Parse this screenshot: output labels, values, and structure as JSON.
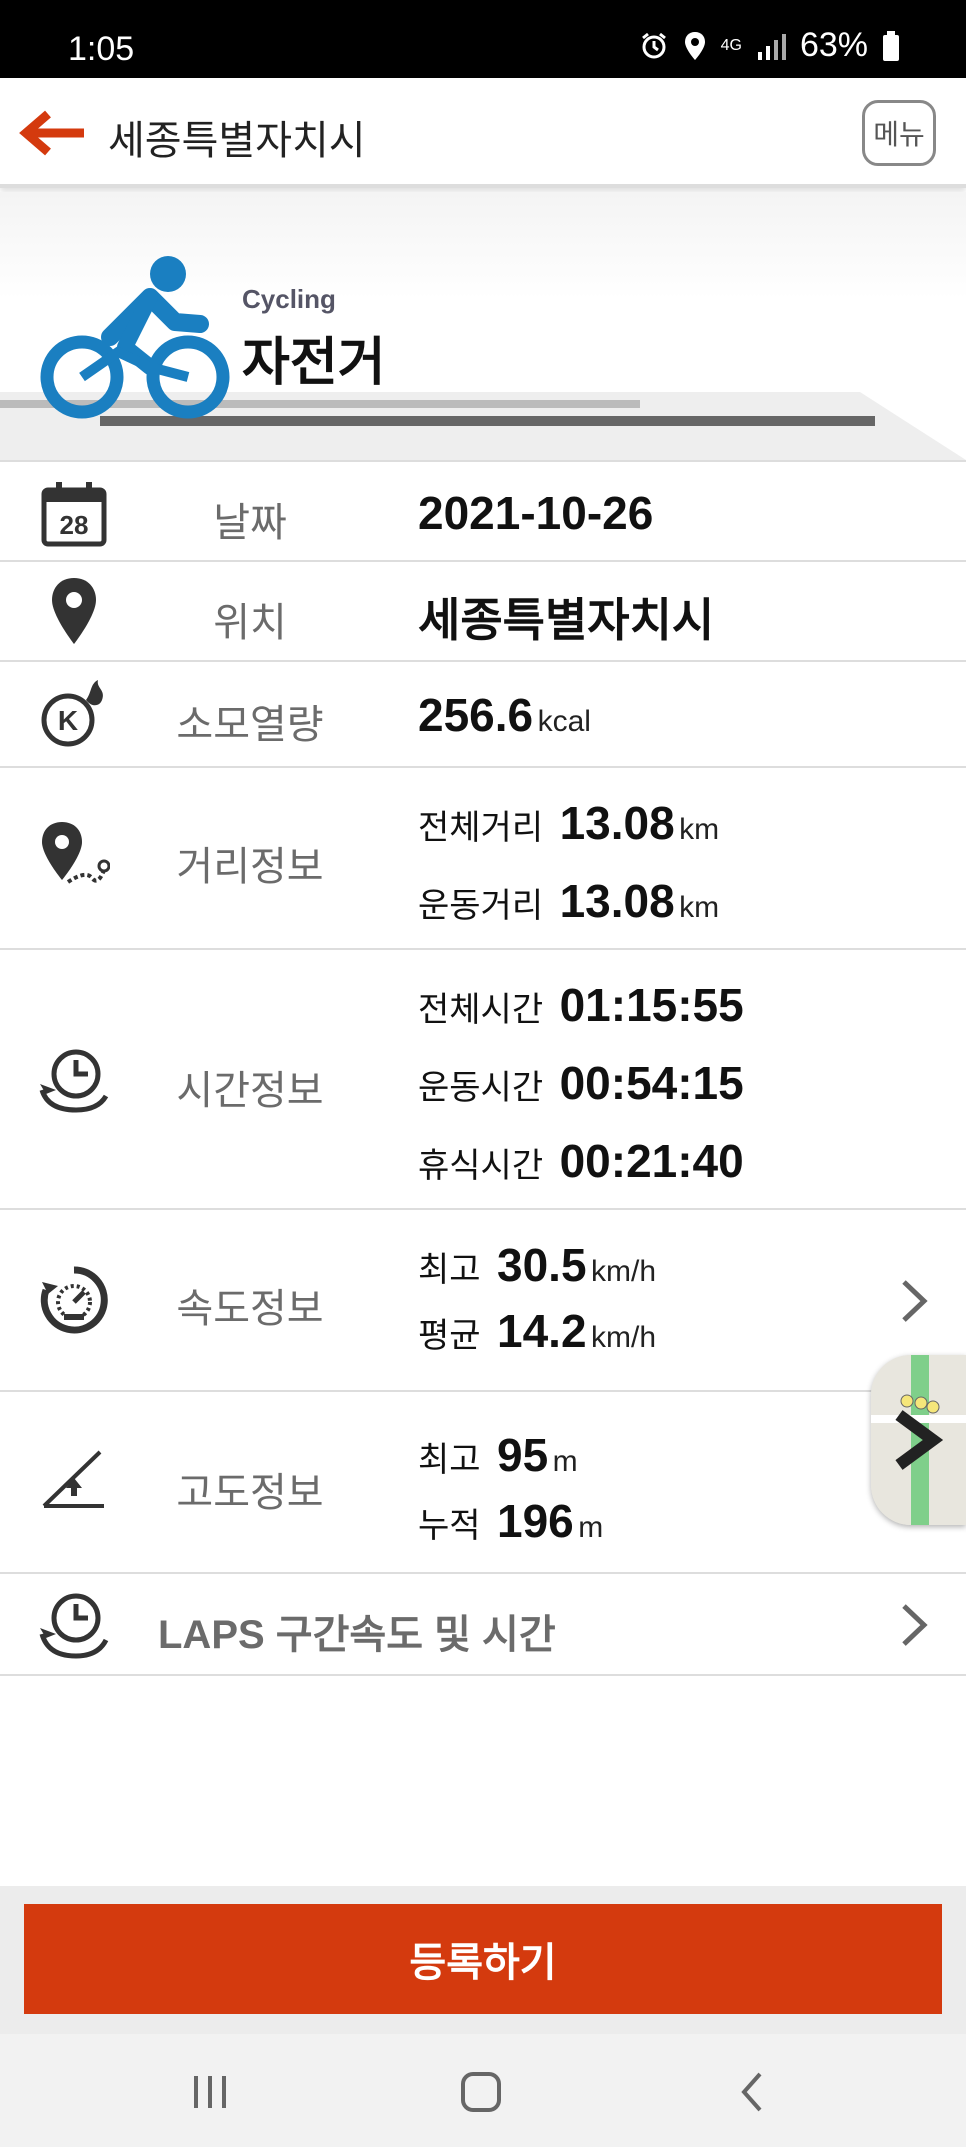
{
  "status_bar": {
    "time": "1:05",
    "network": "4G",
    "battery": "63%"
  },
  "header": {
    "title": "세종특별자치시",
    "menu_label": "메뉴"
  },
  "activity": {
    "type_en": "Cycling",
    "type_ko": "자전거",
    "icon": "cycling-icon"
  },
  "date": {
    "label": "날짜",
    "value": "2021-10-26",
    "calendar_day": "28"
  },
  "location": {
    "label": "위치",
    "value": "세종특별자치시"
  },
  "calories": {
    "label": "소모열량",
    "value": "256.6",
    "unit": "kcal"
  },
  "distance": {
    "label": "거리정보",
    "total_label": "전체거리",
    "total_value": "13.08",
    "total_unit": "km",
    "exercise_label": "운동거리",
    "exercise_value": "13.08",
    "exercise_unit": "km"
  },
  "time": {
    "label": "시간정보",
    "total_label": "전체시간",
    "total_value": "01:15:55",
    "exercise_label": "운동시간",
    "exercise_value": "00:54:15",
    "rest_label": "휴식시간",
    "rest_value": "00:21:40"
  },
  "speed": {
    "label": "속도정보",
    "max_label": "최고",
    "max_value": "30.5",
    "max_unit": "km/h",
    "avg_label": "평균",
    "avg_value": "14.2",
    "avg_unit": "km/h"
  },
  "altitude": {
    "label": "고도정보",
    "max_label": "최고",
    "max_value": "95",
    "max_unit": "m",
    "cumulative_label": "누적",
    "cumulative_value": "196",
    "cumulative_unit": "m"
  },
  "laps": {
    "label": "LAPS 구간속도 및 시간"
  },
  "register_button": "등록하기",
  "colors": {
    "accent": "#d43a0e",
    "cycling_blue": "#1a7fc1",
    "label_gray": "#6b6b6b"
  }
}
